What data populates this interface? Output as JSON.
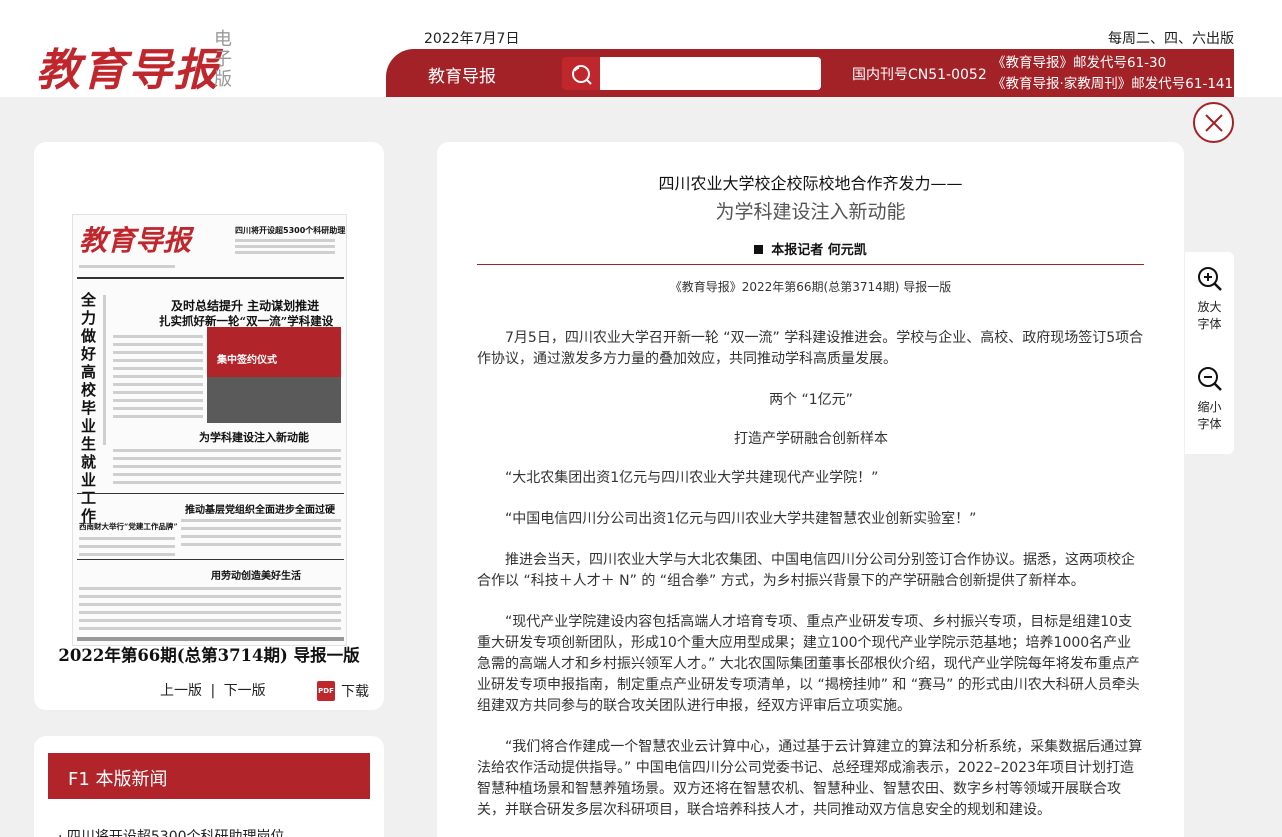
{
  "header": {
    "logo_text": "教育导报",
    "logo_side": "电子版",
    "date": "2022年7月7日",
    "edition": "每周二、四、六出版",
    "bar_title": "教育导报",
    "search_placeholder": "",
    "issn": "国内刊号CN51-0052",
    "postcode1": "《教育导报》邮发代号61-30",
    "postcode2": "《教育导报·家教周刊》邮发代号61-141"
  },
  "thumbnail": {
    "logo": "教育导报",
    "top_right_small": "四川将开设超5300个科研助理岗位",
    "vertical_headline": "全力做好高校毕业生就业工作",
    "headline1": "及时总结提升 主动谋划推进",
    "headline2": "扎实抓好新一轮“双一流”学科建设",
    "photo_caption": "集中签约仪式",
    "story_headline": "为学科建设注入新动能",
    "lower_headline": "推动基层党组织全面进步全面过硬",
    "left_lower": "西南财大举行“党建工作品牌”",
    "bottom_headline": "用劳动创造美好生活"
  },
  "left_card": {
    "issue_label": "2022年第66期(总第3714期) 导报一版",
    "prev": "上一版",
    "separator": "|",
    "next": "下一版",
    "download": "下载",
    "pdf_text": "PDF"
  },
  "news_card": {
    "title": "F1 本版新闻",
    "first_item": "· 四川将开设超5300个科研助理岗位"
  },
  "article": {
    "title": "四川农业大学校企校际校地合作齐发力——",
    "subtitle": "为学科建设注入新动能",
    "author": "本报记者 何元凯",
    "source": "《教育导报》2022年第66期(总第3714期) 导报一版",
    "p1": "7月5日，四川农业大学召开新一轮 “双一流” 学科建设推进会。学校与企业、高校、政府现场签订5项合作协议，通过激发多方力量的叠加效应，共同推动学科高质量发展。",
    "section1": "两个 “1亿元”",
    "section2": "打造产学研融合创新样本",
    "p2": "“大北农集团出资1亿元与四川农业大学共建现代产业学院！”",
    "p3": "“中国电信四川分公司出资1亿元与四川农业大学共建智慧农业创新实验室！”",
    "p4": "推进会当天，四川农业大学与大北农集团、中国电信四川分公司分别签订合作协议。据悉，这两项校企合作以 “科技＋人才＋ N” 的 “组合拳” 方式，为乡村振兴背景下的产学研融合创新提供了新样本。",
    "p5": "“现代产业学院建设内容包括高端人才培育专项、重点产业研发专项、乡村振兴专项，目标是组建10支重大研发专项创新团队，形成10个重大应用型成果；建立100个现代产业学院示范基地；培养1000名产业急需的高端人才和乡村振兴领军人才。” 大北农国际集团董事长邵根伙介绍，现代产业学院每年将发布重点产业研发专项申报指南，制定重点产业研发专项清单，以 “揭榜挂帅” 和 “赛马” 的形式由川农大科研人员牵头组建双方共同参与的联合攻关团队进行申报，经双方评审后立项实施。",
    "p6": "“我们将合作建成一个智慧农业云计算中心，通过基于云计算建立的算法和分析系统，采集数据后通过算法给农作活动提供指导。” 中国电信四川分公司党委书记、总经理郑成渝表示，2022–2023年项目计划打造智慧种植场景和智慧养殖场景。双方还将在智慧农机、智慧种业、智慧农田、数字乡村等领域开展联合攻关，并联合研发多层次科研项目，联合培养科技人才，共同推动双方信息安全的规划和建设。"
  },
  "tools": {
    "zoom_in": "放大字体",
    "zoom_out": "缩小字体"
  },
  "colors": {
    "brand_red": "#a32228",
    "logo_red": "#c0272d",
    "background": "#f0f0f0"
  }
}
